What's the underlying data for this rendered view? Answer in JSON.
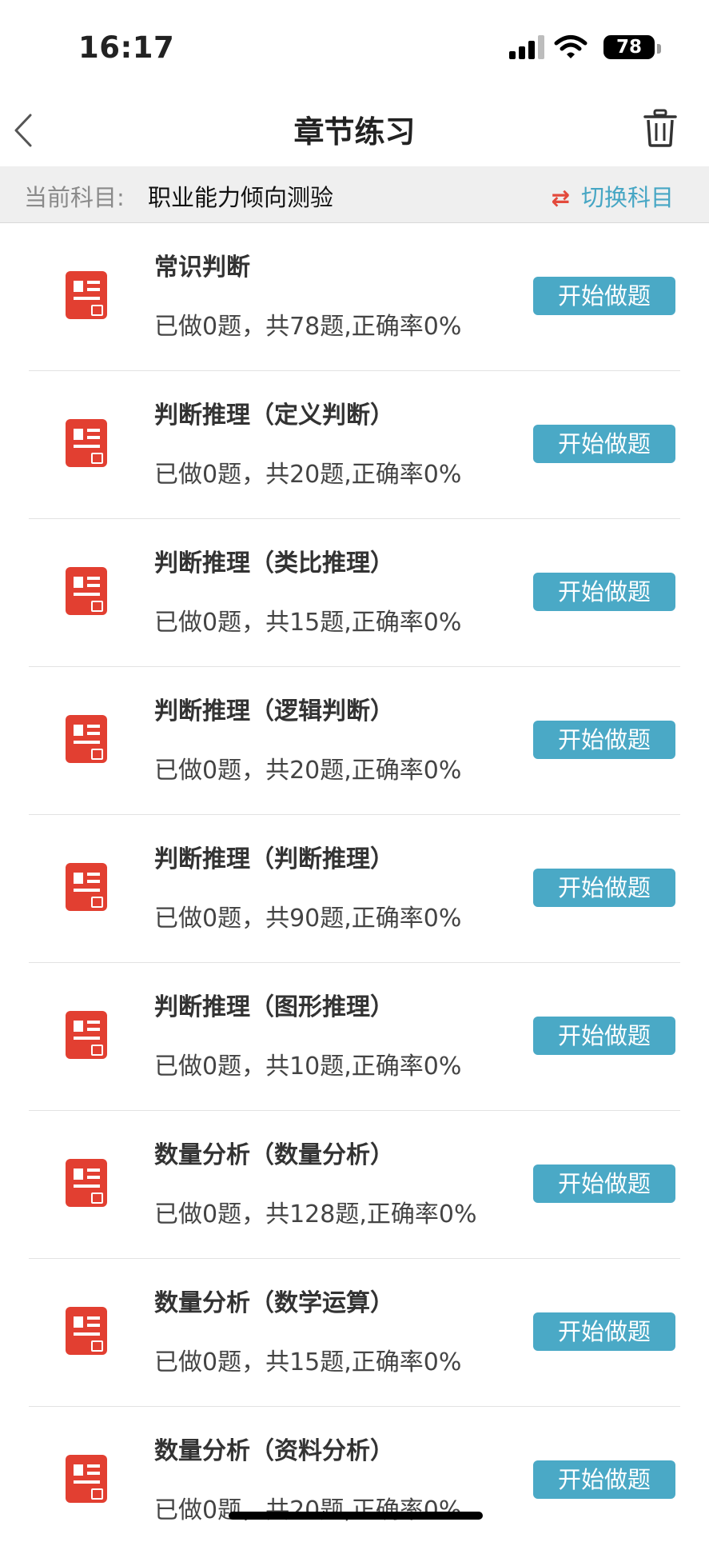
{
  "status_bar": {
    "time": "16:17",
    "battery": "78"
  },
  "nav": {
    "title": "章节练习",
    "back_icon": "chevron-left-icon",
    "trash_icon": "trash-icon"
  },
  "subject": {
    "label": "当前科目:",
    "value": "职业能力倾向测验",
    "switch_label": "切换科目",
    "switch_icon": "⇄"
  },
  "colors": {
    "accent": "#4aa9c6",
    "icon_red": "#e23f31"
  },
  "chapters": [
    {
      "title": "常识判断",
      "stats": "已做0题，共78题,正确率0%",
      "button": "开始做题"
    },
    {
      "title": "判断推理（定义判断）",
      "stats": "已做0题，共20题,正确率0%",
      "button": "开始做题"
    },
    {
      "title": "判断推理（类比推理）",
      "stats": "已做0题，共15题,正确率0%",
      "button": "开始做题"
    },
    {
      "title": "判断推理（逻辑判断）",
      "stats": "已做0题，共20题,正确率0%",
      "button": "开始做题"
    },
    {
      "title": "判断推理（判断推理）",
      "stats": "已做0题，共90题,正确率0%",
      "button": "开始做题"
    },
    {
      "title": "判断推理（图形推理）",
      "stats": "已做0题，共10题,正确率0%",
      "button": "开始做题"
    },
    {
      "title": "数量分析（数量分析）",
      "stats": "已做0题，共128题,正确率0%",
      "button": "开始做题"
    },
    {
      "title": "数量分析（数学运算）",
      "stats": "已做0题，共15题,正确率0%",
      "button": "开始做题"
    },
    {
      "title": "数量分析（资料分析）",
      "stats": "已做0题，共20题,正确率0%",
      "button": "开始做题"
    }
  ]
}
